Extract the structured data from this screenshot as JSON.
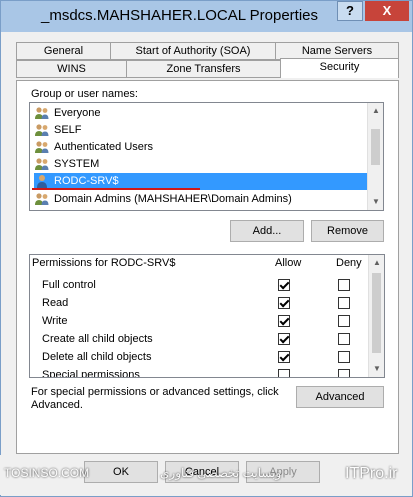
{
  "window": {
    "title": "_msdcs.MAHSHAHER.LOCAL Properties",
    "help_label": "?",
    "close_label": "X"
  },
  "tabs_row1": [
    {
      "label": "General"
    },
    {
      "label": "Start of Authority (SOA)"
    },
    {
      "label": "Name Servers"
    }
  ],
  "tabs_row2": [
    {
      "label": "WINS"
    },
    {
      "label": "Zone Transfers"
    },
    {
      "label": "Security"
    }
  ],
  "groups": {
    "label": "Group or user names:",
    "items": [
      {
        "name": "Everyone",
        "icon": "users-group-icon"
      },
      {
        "name": "SELF",
        "icon": "users-group-icon"
      },
      {
        "name": "Authenticated Users",
        "icon": "users-group-icon"
      },
      {
        "name": "SYSTEM",
        "icon": "users-group-icon"
      },
      {
        "name": "RODC-SRV$",
        "icon": "user-icon",
        "selected": true
      },
      {
        "name": "Domain Admins (MAHSHAHER\\Domain Admins)",
        "icon": "users-group-icon"
      }
    ],
    "add_label": "Add...",
    "remove_label": "Remove"
  },
  "permissions": {
    "label": "Permissions for RODC-SRV$",
    "allow_label": "Allow",
    "deny_label": "Deny",
    "rows": [
      {
        "name": "Full control",
        "allow": true,
        "deny": false
      },
      {
        "name": "Read",
        "allow": true,
        "deny": false
      },
      {
        "name": "Write",
        "allow": true,
        "deny": false
      },
      {
        "name": "Create all child objects",
        "allow": true,
        "deny": false
      },
      {
        "name": "Delete all child objects",
        "allow": true,
        "deny": false
      },
      {
        "name": "Special permissions",
        "allow": false,
        "deny": false
      }
    ]
  },
  "advanced": {
    "text": "For special permissions or advanced settings, click Advanced.",
    "button_label": "Advanced"
  },
  "footer": {
    "ok_label": "OK",
    "cancel_label": "Cancel",
    "apply_label": "Apply",
    "watermark_left": "TOSINSO.COM",
    "watermark_mid": "وبسایت تخصصی فناوری",
    "watermark_right": "ITPro.ir"
  }
}
